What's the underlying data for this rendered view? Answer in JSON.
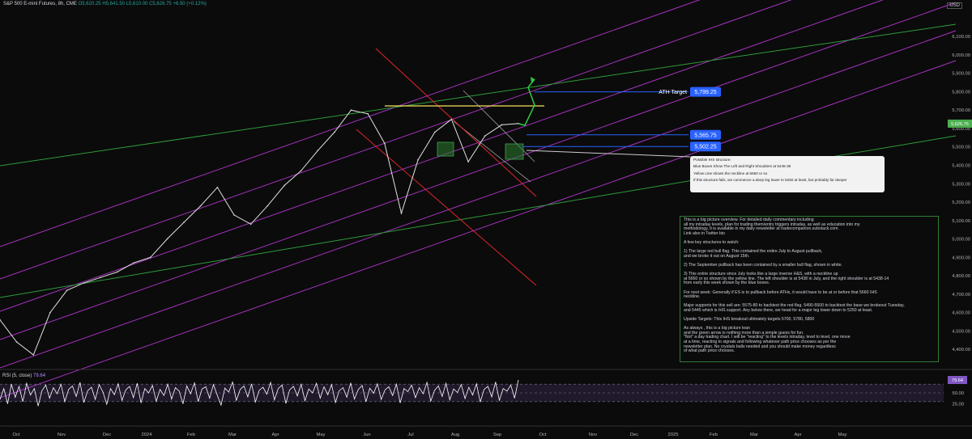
{
  "header": {
    "symbol": "S&P 500 E-mini Futures, 8h, CME",
    "open": "O5,620.25",
    "high": "H5,641.50",
    "low": "L5,610.00",
    "close": "C5,626.75",
    "change": "+6.50 (+0.12%)"
  },
  "currency_label": "USD",
  "colors": {
    "background": "#0b0b0b",
    "price_line": "#e0e0e0",
    "channel_magenta": "#c23ae0",
    "channel_green": "#2e9b3a",
    "red_flag": "#e0262a",
    "neckline": "#f6e05e",
    "box_green": "#2e7d32",
    "arrow_green": "#2ecc40",
    "label_blue": "#2962ff",
    "current_price": "#4caf50",
    "rsi_line": "#ffffff",
    "rsi_band": "#7e57c2"
  },
  "chart_data": [
    {
      "type": "line",
      "title": "S&P 500 E-mini Futures, 8h, CME",
      "y_axis_ticks": [
        "6,100.00",
        "6,000.00",
        "5,900.00",
        "5,800.00",
        "5,700.00",
        "5,600.00",
        "5,500.00",
        "5,400.00",
        "5,300.00",
        "5,200.00",
        "5,100.00",
        "5,000.00",
        "4,900.00",
        "4,800.00",
        "4,700.00",
        "4,600.00",
        "4,500.00",
        "4,400.00"
      ],
      "x_axis_ticks": [
        "Oct",
        "Nov",
        "Dec",
        "2024",
        "Feb",
        "Mar",
        "Apr",
        "May",
        "Jun",
        "Jul",
        "Aug",
        "Sep",
        "Oct",
        "Nov",
        "Dec",
        "2025",
        "Feb",
        "Mar",
        "Apr",
        "May"
      ],
      "ylim": [
        4330,
        6180
      ],
      "current_price": "5,626.75",
      "x": [
        "Oct",
        "Oct",
        "Nov",
        "Nov",
        "Nov",
        "Dec",
        "Dec",
        "2024",
        "2024",
        "Feb",
        "Feb",
        "Mar",
        "Mar",
        "Apr",
        "Apr",
        "Apr",
        "May",
        "May",
        "Jun",
        "Jun",
        "Jul",
        "Jul",
        "Jul",
        "Aug",
        "Aug",
        "Aug",
        "Aug",
        "Sep",
        "Sep",
        "Sep",
        "Sep",
        "Sep"
      ],
      "y": [
        4560,
        4440,
        4370,
        4600,
        4720,
        4760,
        4790,
        4820,
        4870,
        4900,
        5000,
        5090,
        5180,
        5280,
        5130,
        5080,
        5180,
        5290,
        5370,
        5480,
        5580,
        5700,
        5680,
        5520,
        5140,
        5430,
        5580,
        5650,
        5420,
        5560,
        5620,
        5627
      ],
      "annotations": [
        {
          "label": "ATH Target",
          "value": "5,799.25"
        },
        {
          "label": "",
          "value": "5,565.75"
        },
        {
          "label": "",
          "value": "5,502.25"
        }
      ]
    },
    {
      "type": "line",
      "title": "RSI (5, close)",
      "value_label": "79.64",
      "y_axis_ticks": [
        "75.00",
        "50.00",
        "25.00"
      ],
      "ylim": [
        0,
        100
      ],
      "values": [
        35,
        60,
        25,
        70,
        40,
        65,
        30,
        72,
        45,
        60,
        20,
        55,
        68,
        38,
        62,
        48,
        70,
        30,
        58,
        66,
        42,
        74,
        28,
        55,
        63,
        35,
        69,
        52,
        24,
        60,
        46,
        71,
        33,
        57,
        65,
        39,
        72,
        27,
        60,
        50,
        67,
        31,
        58,
        44,
        70,
        36,
        62,
        54,
        25,
        66,
        48,
        73,
        30,
        59,
        64,
        38,
        69,
        45,
        22,
        61,
        52,
        75,
        33,
        58,
        66,
        41,
        71,
        29,
        56,
        63,
        47,
        74,
        34,
        60,
        68,
        26,
        57,
        65,
        43,
        70,
        32,
        59,
        50,
        72,
        38,
        64,
        46,
        69,
        28,
        55,
        62,
        40,
        73,
        36,
        58,
        67,
        30,
        61,
        49,
        71,
        35,
        57,
        64,
        44,
        70,
        27,
        60,
        53,
        68,
        39,
        62,
        48,
        74,
        31,
        56,
        66,
        42,
        72,
        34,
        59,
        51,
        69,
        37,
        63,
        45,
        71,
        29,
        58,
        65,
        41,
        75,
        33,
        60,
        54,
        68,
        38,
        79.64
      ]
    }
  ],
  "ihs_note": {
    "title": "Possible IHS structure:",
    "line1": "Blue Boxes Show The Left and Right Shoulders at 5445-38",
    "line2": "Yellow Line shows the neckline at 5660 or so",
    "line3": "If this structure fails, we commence a deep leg lower to 5250 at least, but probably far deeper"
  },
  "commentary": {
    "lines": [
      "This is a big picture overview. For detailed daily commentary including",
      "all my intraday levels, plan for trading them/entry triggers intraday, as well as education into my",
      "methodology, it is available in my daily newsletter at tradecompanion.substack.com.",
      "Link also in Twitter bio",
      "",
      "A few key structures to watch:",
      "",
      "1) The large red bull flag. This contained the entire July to August pullback,",
      "and we broke it out on August 15th.",
      "",
      "2) The September pullback has been contained by a smaller bull flag, shown in white.",
      "",
      "3) This entire structure since July looks like a large inverse H&S, with a neckline up",
      "at 5660 or so shown by the yellow line. The left shoulder is at 5438 in July, and the right shoulder is at 5438-14",
      "from early this week shown by the blue boxes.",
      "",
      "For next week: Generally if ES is to pullback before ATHs, it would have to be at or before that 5660 IHS",
      "neckline.",
      "",
      "Major supports for this sell are: 5575-80 to backtest the red flag. 5490-5500 to backtest the base we brokeout Tuesday,",
      "and 5445 which is IHS support. Any below there, we head for a major leg lower down to 5250 at least.",
      "",
      "Upside Targets: This IHS breakout ultimately targets 5700, 5780, 5800",
      "",
      "As always , this is a big picture lean",
      "and the green arrow is nothing more than a simple guess for fun.",
      "\"Not\" a day trading chart. I will be \"reacting\" to the levels intraday, level to level, one move",
      "at a time, reacting to signals and following whatever path price chooses as per the",
      "newsletter plan. No crystals balls needed and you should make money regardless",
      "of what path price chooses."
    ]
  }
}
